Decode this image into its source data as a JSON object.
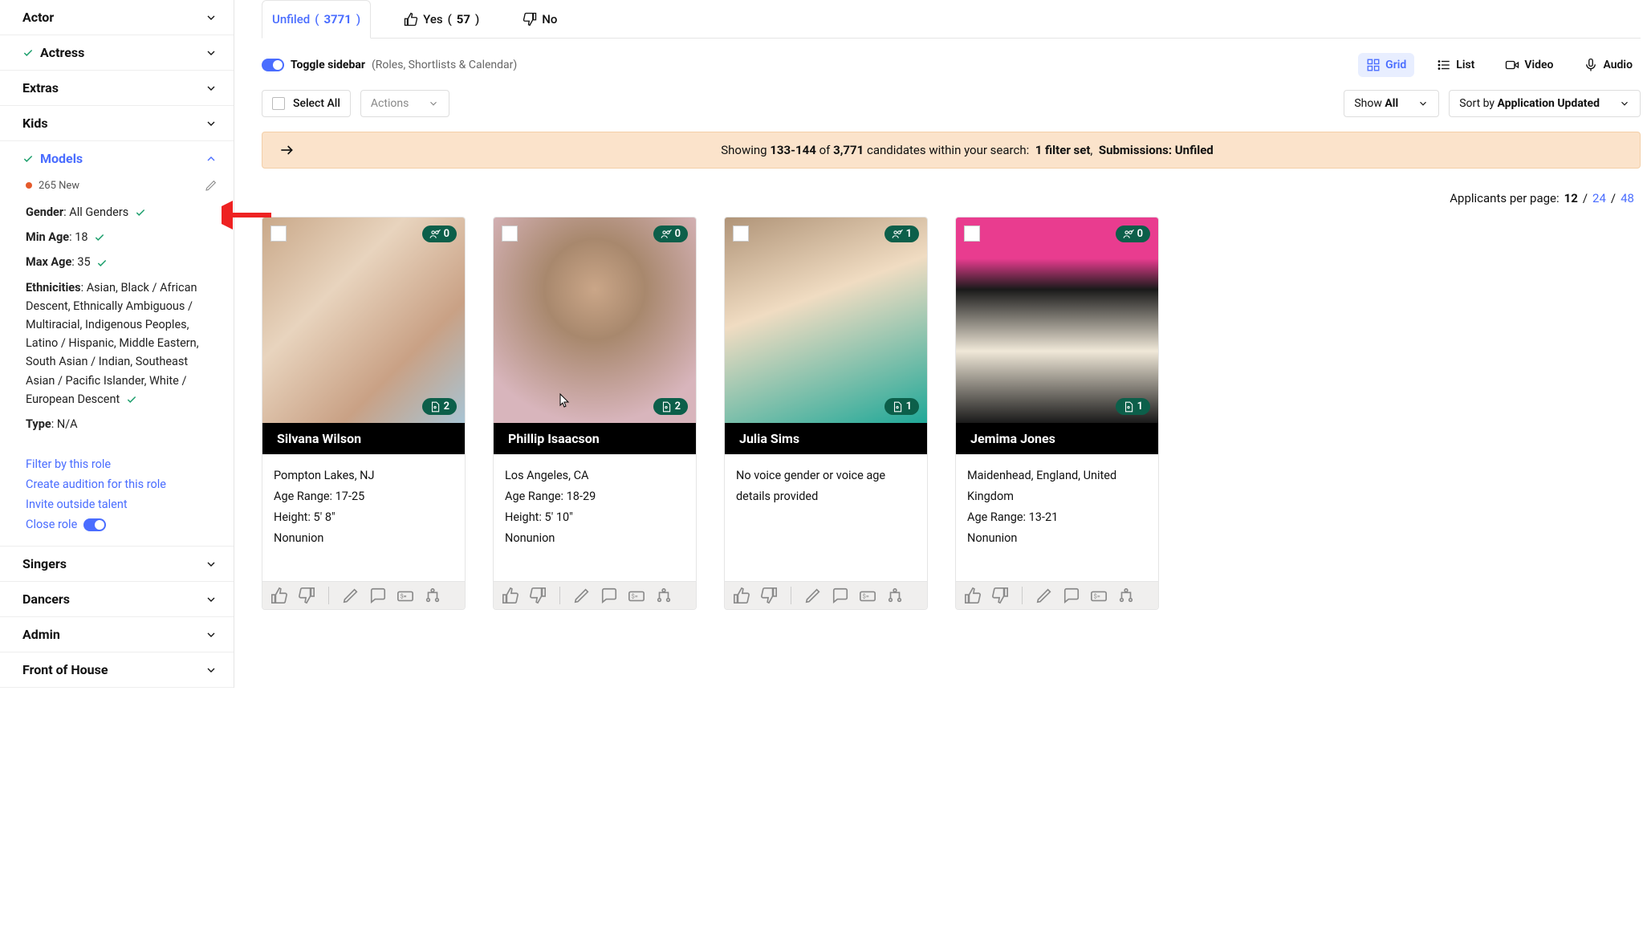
{
  "sidebar": {
    "roles": [
      {
        "key": "actor",
        "label": "Actor",
        "checked": false
      },
      {
        "key": "actress",
        "label": "Actress",
        "checked": true
      },
      {
        "key": "extras",
        "label": "Extras",
        "checked": false
      },
      {
        "key": "kids",
        "label": "Kids",
        "checked": false
      },
      {
        "key": "models",
        "label": "Models",
        "checked": true,
        "active": true
      },
      {
        "key": "singers",
        "label": "Singers",
        "checked": false
      },
      {
        "key": "dancers",
        "label": "Dancers",
        "checked": false
      },
      {
        "key": "admin",
        "label": "Admin",
        "checked": false
      },
      {
        "key": "foh",
        "label": "Front of House",
        "checked": false
      }
    ],
    "new_count": "265 New",
    "filters": {
      "gender_label": "Gender",
      "gender_value": "All Genders",
      "min_age_label": "Min Age",
      "min_age_value": "18",
      "max_age_label": "Max Age",
      "max_age_value": "35",
      "ethnicities_label": "Ethnicities",
      "ethnicities_value": "Asian, Black / African Descent, Ethnically Ambiguous / Multiracial, Indigenous Peoples, Latino / Hispanic, Middle Eastern, South Asian / Indian, Southeast Asian / Pacific Islander, White / European Descent",
      "type_label": "Type",
      "type_value": "N/A"
    },
    "links": {
      "filter_role": "Filter by this role",
      "create_audition": "Create audition for this role",
      "invite_talent": "Invite outside talent",
      "close_role": "Close role"
    }
  },
  "tabs": {
    "unfiled": {
      "label": "Unfiled",
      "count": "3771"
    },
    "yes": {
      "label": "Yes",
      "count": "57"
    },
    "no": {
      "label": "No"
    }
  },
  "toolbar": {
    "toggle_label": "Toggle sidebar",
    "toggle_hint": "(Roles, Shortlists & Calendar)",
    "grid": "Grid",
    "list": "List",
    "video": "Video",
    "audio": "Audio",
    "select_all": "Select All",
    "actions": "Actions",
    "show_label": "Show",
    "show_value": "All",
    "sort_label": "Sort by",
    "sort_value": "Application Updated"
  },
  "banner": {
    "pre": "Showing",
    "range": "133-144",
    "mid": "of",
    "total": "3,771",
    "post": "candidates within your search:",
    "filter": "1 filter set",
    "subs": "Submissions: Unfiled"
  },
  "perpage": {
    "label": "Applicants per page:",
    "opts": [
      "12",
      "24",
      "48"
    ],
    "active": "12"
  },
  "cards": [
    {
      "name": "Silvana Wilson",
      "top_count": "0",
      "bot_count": "2",
      "lines": [
        "Pompton Lakes, NJ",
        "Age Range: 17-25",
        "Height: 5' 8\"",
        "Nonunion"
      ]
    },
    {
      "name": "Phillip Isaacson",
      "top_count": "0",
      "bot_count": "2",
      "lines": [
        "Los Angeles, CA",
        "Age Range: 18-29",
        "Height: 5' 10\"",
        "Nonunion"
      ]
    },
    {
      "name": "Julia Sims",
      "top_count": "1",
      "bot_count": "1",
      "lines": [
        "No voice gender or voice age details provided"
      ]
    },
    {
      "name": "Jemima Jones",
      "top_count": "0",
      "bot_count": "1",
      "lines": [
        "Maidenhead, England, United Kingdom",
        "Age Range: 13-21",
        "Nonunion"
      ]
    }
  ]
}
